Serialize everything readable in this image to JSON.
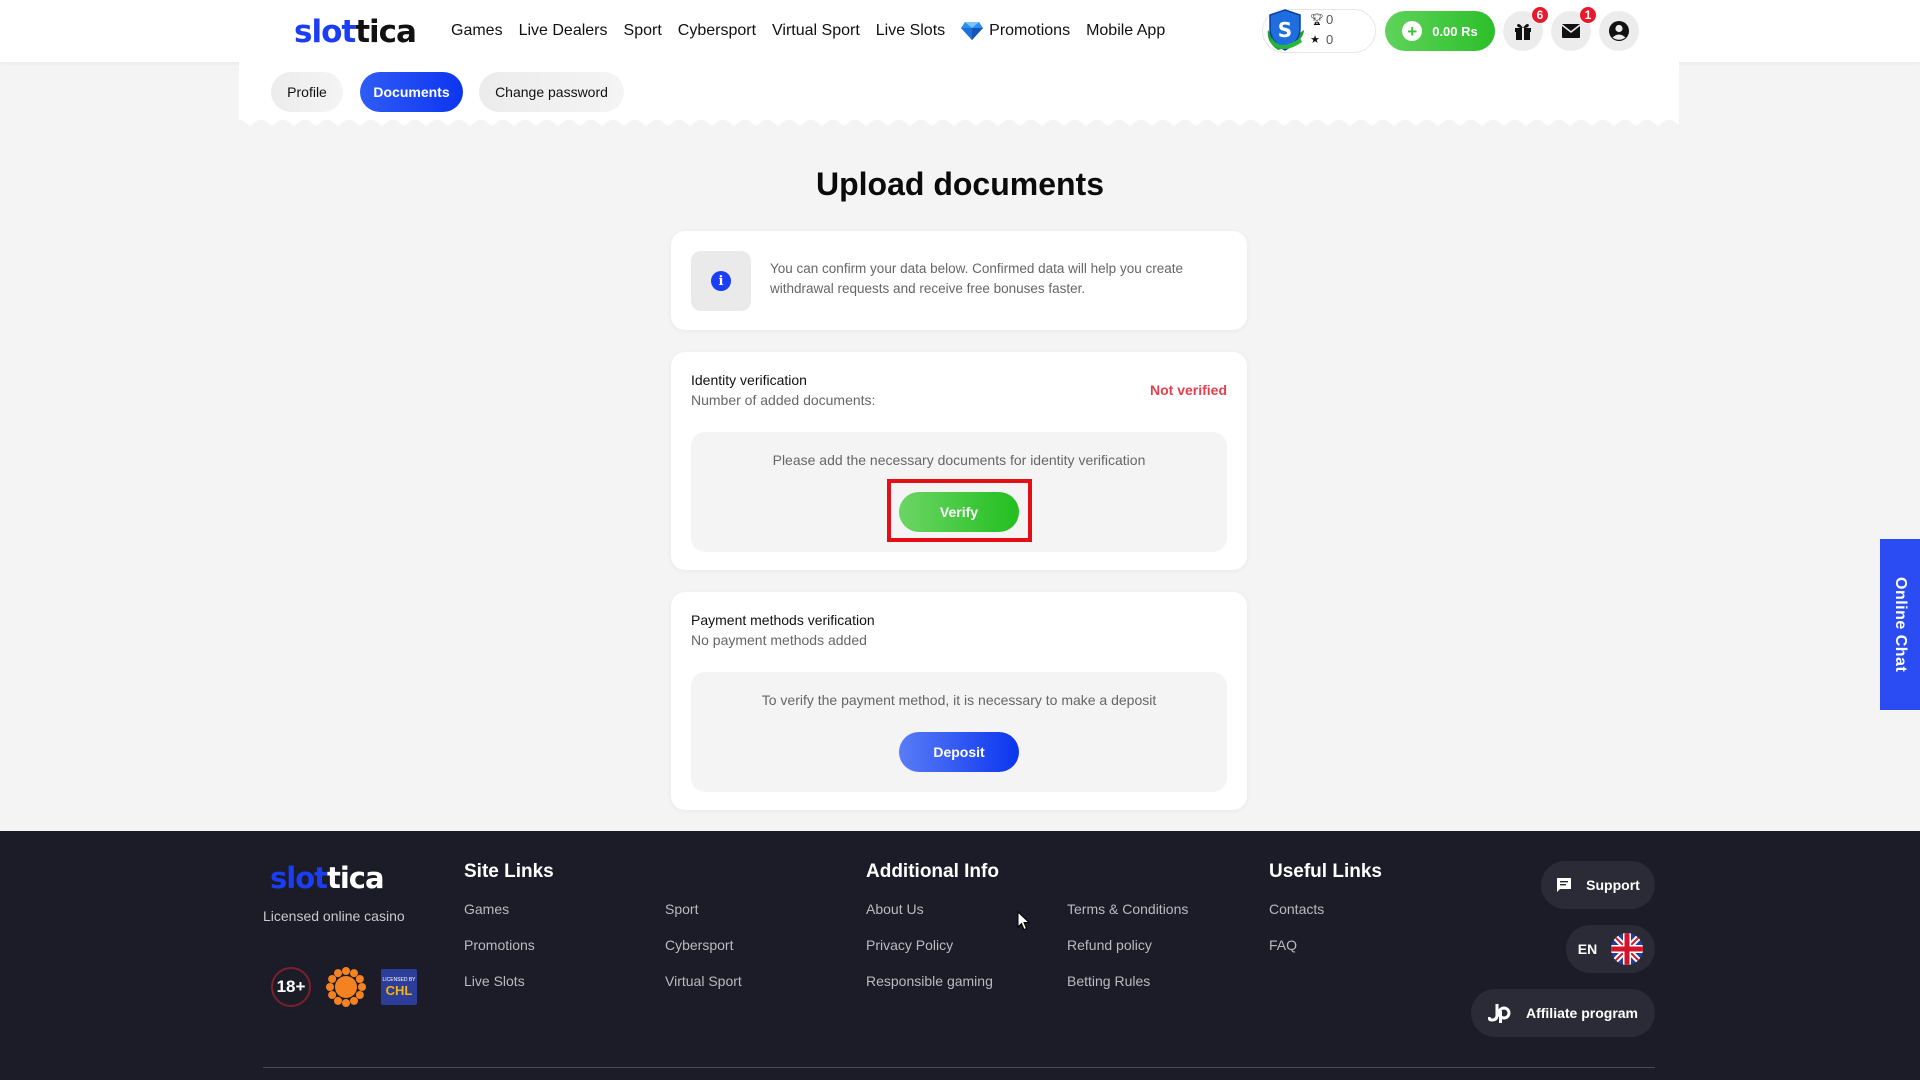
{
  "header": {
    "logo_part1": "slot",
    "logo_part2": "tica",
    "nav": [
      {
        "label": "Games"
      },
      {
        "label": "Live Dealers"
      },
      {
        "label": "Sport"
      },
      {
        "label": "Cybersport"
      },
      {
        "label": "Virtual Sport"
      },
      {
        "label": "Live Slots"
      },
      {
        "label": "Promotions",
        "icon": "diamond-icon"
      },
      {
        "label": "Mobile App"
      }
    ],
    "status": {
      "level_icon": "shield-s-icon",
      "trophies": "0",
      "stars": "0"
    },
    "balance": "0.00 Rs",
    "gift_badge": "6",
    "messages_badge": "1",
    "colors": {
      "brand": "#1a3df5",
      "green": "#2cbf2a",
      "badge": "#e8192c"
    }
  },
  "tabs": [
    {
      "label": "Profile",
      "active": false
    },
    {
      "label": "Documents",
      "active": true
    },
    {
      "label": "Change password",
      "active": false
    }
  ],
  "main": {
    "title": "Upload documents",
    "info_text": "You can confirm your data below. Confirmed data will help you create withdrawal requests and receive free bonuses faster.",
    "identity": {
      "title": "Identity verification",
      "subtitle": "Number of added documents:",
      "status": "Not verified",
      "prompt": "Please add the necessary documents for identity verification",
      "button": "Verify"
    },
    "payment": {
      "title": "Payment methods verification",
      "subtitle": "No payment methods added",
      "prompt": "To verify the payment method, it is necessary to make a deposit",
      "button": "Deposit"
    }
  },
  "online_chat": "Online Chat",
  "footer": {
    "logo_part1": "slot",
    "logo_part2": "tica",
    "tagline": "Licensed online casino",
    "badges": {
      "age": "18+",
      "license_top": "LICENSED BY",
      "license_mark": "CHL"
    },
    "site_links": {
      "title": "Site Links",
      "col1": [
        "Games",
        "Promotions",
        "Live Slots"
      ],
      "col2": [
        "Sport",
        "Cybersport",
        "Virtual Sport"
      ]
    },
    "additional_info": {
      "title": "Additional Info",
      "col1": [
        "About Us",
        "Privacy Policy",
        "Responsible gaming"
      ],
      "col2": [
        "Terms & Conditions",
        "Refund policy",
        "Betting Rules"
      ]
    },
    "useful_links": {
      "title": "Useful Links",
      "items": [
        "Contacts",
        "FAQ"
      ]
    },
    "support": "Support",
    "language": "EN",
    "affiliate": "Affiliate program"
  }
}
